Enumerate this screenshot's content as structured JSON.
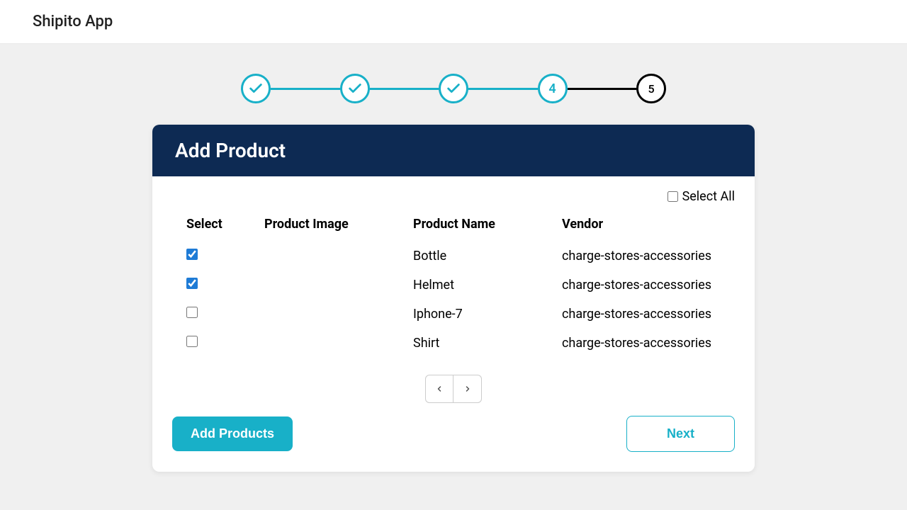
{
  "app": {
    "title": "Shipito App"
  },
  "stepper": {
    "steps": [
      {
        "status": "done"
      },
      {
        "status": "done"
      },
      {
        "status": "done"
      },
      {
        "status": "current",
        "label": "4"
      },
      {
        "status": "future",
        "label": "5"
      }
    ]
  },
  "card": {
    "title": "Add Product",
    "select_all_label": "Select All",
    "select_all_checked": false,
    "columns": {
      "select": "Select",
      "image": "Product Image",
      "name": "Product Name",
      "vendor": "Vendor"
    },
    "rows": [
      {
        "checked": true,
        "name": "Bottle",
        "vendor": "charge-stores-accessories"
      },
      {
        "checked": true,
        "name": "Helmet",
        "vendor": "charge-stores-accessories"
      },
      {
        "checked": false,
        "name": "Iphone-7",
        "vendor": "charge-stores-accessories"
      },
      {
        "checked": false,
        "name": "Shirt",
        "vendor": "charge-stores-accessories"
      }
    ],
    "buttons": {
      "add": "Add Products",
      "next": "Next"
    }
  },
  "colors": {
    "accent": "#18b0c8",
    "header_bg": "#0d2a53"
  }
}
